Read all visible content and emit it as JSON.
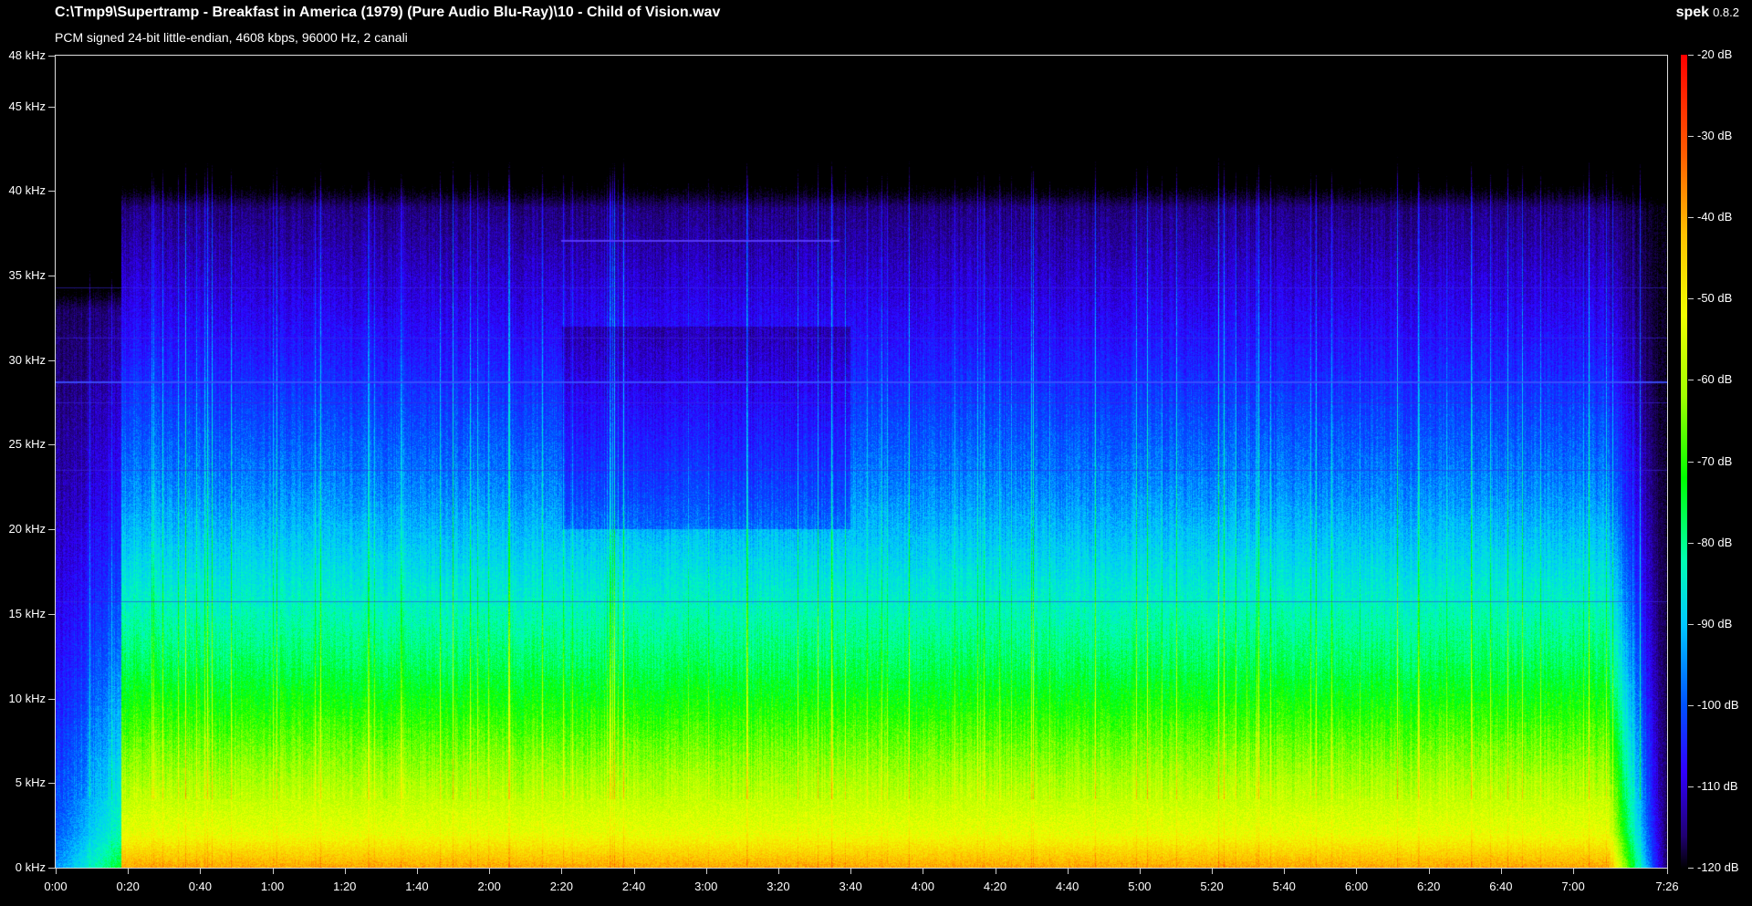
{
  "header": {
    "file_path": "C:\\Tmp9\\Supertramp - Breakfast in America (1979) (Pure Audio Blu-Ray)\\10 - Child of Vision.wav",
    "format_info": "PCM signed 24-bit little-endian, 4608 kbps, 96000 Hz, 2 canali"
  },
  "brand": {
    "name": "spek",
    "version": "0.8.2"
  },
  "chart_data": {
    "type": "heatmap",
    "x_tick_labels": [
      "0:00",
      "0:20",
      "0:40",
      "1:00",
      "1:20",
      "1:40",
      "2:00",
      "2:20",
      "2:40",
      "3:00",
      "3:20",
      "3:40",
      "4:00",
      "4:20",
      "4:40",
      "5:00",
      "5:20",
      "5:40",
      "6:00",
      "6:20",
      "6:40",
      "7:00",
      "7:26"
    ],
    "x_tick_seconds": [
      0,
      20,
      40,
      60,
      80,
      100,
      120,
      140,
      160,
      180,
      200,
      220,
      240,
      260,
      280,
      300,
      320,
      340,
      360,
      380,
      400,
      420,
      446
    ],
    "x_range_seconds": [
      0,
      446
    ],
    "y_tick_labels": [
      "0 kHz",
      "5 kHz",
      "10 kHz",
      "15 kHz",
      "20 kHz",
      "25 kHz",
      "30 kHz",
      "35 kHz",
      "40 kHz",
      "45 kHz",
      "48 kHz"
    ],
    "y_tick_khz": [
      0,
      5,
      10,
      15,
      20,
      25,
      30,
      35,
      40,
      45,
      48
    ],
    "y_range_khz": [
      0,
      48
    ],
    "colorbar_labels": [
      "-20 dB",
      "-30 dB",
      "-40 dB",
      "-50 dB",
      "-60 dB",
      "-70 dB",
      "-80 dB",
      "-90 dB",
      "-100 dB",
      "-110 dB",
      "-120 dB"
    ],
    "colorbar_db": [
      -20,
      -30,
      -40,
      -50,
      -60,
      -70,
      -80,
      -90,
      -100,
      -110,
      -120
    ],
    "colorbar_range_db": [
      -120,
      -20
    ],
    "colors": [
      "#000000",
      "#200070",
      "#3000ff",
      "#0050ff",
      "#00c8ff",
      "#00ffb0",
      "#00ff00",
      "#a0ff00",
      "#f0ff00",
      "#ffc000",
      "#ff5a00",
      "#ff0000"
    ],
    "approx_cutoff_khz": 39,
    "horizontal_lines_khz": [
      28.7,
      27.5,
      34.3,
      31.3,
      23.5,
      15.7
    ],
    "notable_segment": {
      "from_s": 140,
      "to_s": 217,
      "freq_khz": 37.1
    }
  }
}
